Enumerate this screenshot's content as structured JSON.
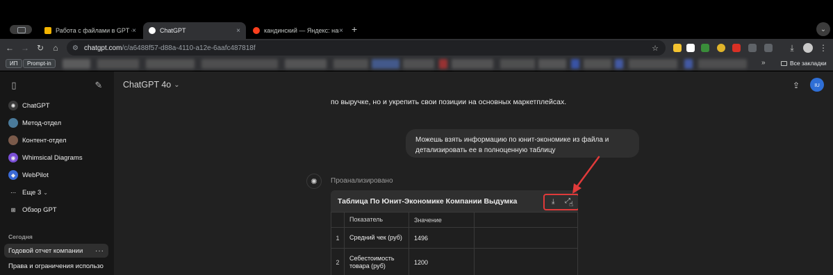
{
  "browser": {
    "tabs": [
      {
        "title": "Работа с файлами в GPT - G",
        "favicon_color": "#f4b400",
        "active": false
      },
      {
        "title": "ChatGPT",
        "favicon_color": "#ffffff",
        "active": true
      },
      {
        "title": "кандинский — Яндекс: наш",
        "favicon_color": "#fc3f1d",
        "active": false
      }
    ],
    "tab_close": "×",
    "new_tab": "+",
    "tab_menu": "⌄",
    "url_host": "chatgpt.com",
    "url_path": "/c/a6488f57-d88a-4110-a12e-6aafc487818f",
    "bookmarks": {
      "chip1": "ИП",
      "chip2": "Prompt-in",
      "more": "»",
      "folder": "Все закладки"
    }
  },
  "sidebar": {
    "items": [
      {
        "label": "ChatGPT",
        "icon": "chatgpt-icon",
        "color": "#3a3a3a"
      },
      {
        "label": "Метод-отдел",
        "icon": "gpt-avatar-icon",
        "color": "#4a7a9a"
      },
      {
        "label": "Контент-отдел",
        "icon": "gpt-avatar-icon",
        "color": "#7a5a4a"
      },
      {
        "label": "Whimsical Diagrams",
        "icon": "whimsical-icon",
        "color": "#7a4fd6"
      },
      {
        "label": "WebPilot",
        "icon": "webpilot-icon",
        "color": "#3a6ad6"
      }
    ],
    "more_label": "Еще 3",
    "explore_label": "Обзор GPT",
    "section_today": "Сегодня",
    "chats": [
      {
        "title": "Годовой отчет компании",
        "active": true
      },
      {
        "title": "Права и ограничения использо",
        "active": false
      }
    ]
  },
  "header": {
    "model": "ChatGPT 4o",
    "user_initials": "IU"
  },
  "conversation": {
    "previous_text": "по выручке, но и укрепить свои позиции на основных маркетплейсах.",
    "user_message": "Можешь взять информацию по юнит-экономике из файла и детализировать ее в полноценную таблицу",
    "analyzed_label": "Проанализировано",
    "table": {
      "title": "Таблица По Юнит-Экономике Компании Выдумка",
      "headers": [
        "Показатель",
        "Значение"
      ],
      "rows": [
        {
          "n": "1",
          "metric": "Средний чек (руб)",
          "value": "1496"
        },
        {
          "n": "2",
          "metric": "Себестоимость товара (руб)",
          "value": "1200"
        }
      ]
    }
  },
  "colors": {
    "accent_annotation": "#e03a3a",
    "user_avatar": "#2f6fd6"
  }
}
